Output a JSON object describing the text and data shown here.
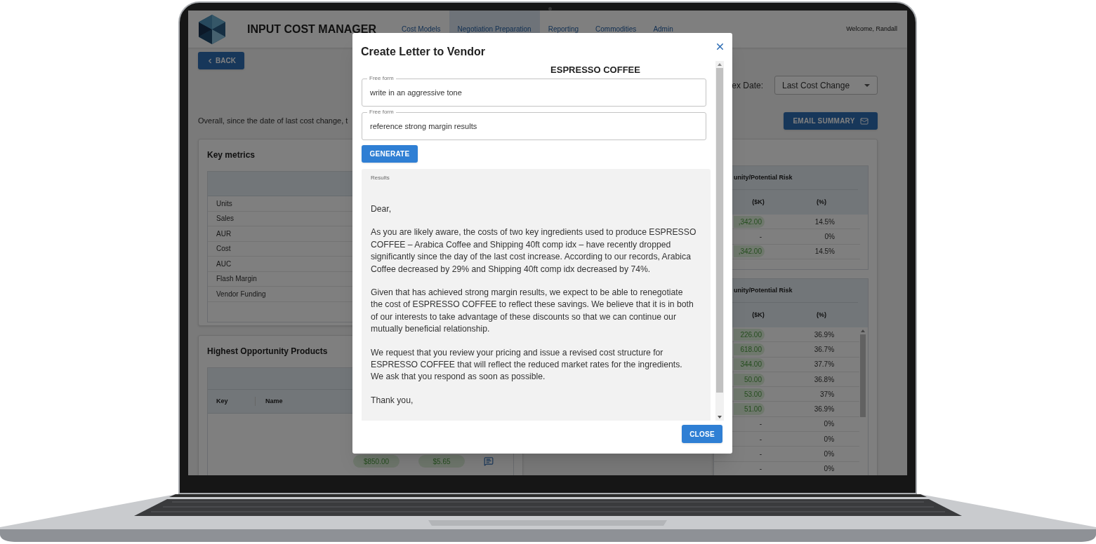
{
  "app": {
    "title": "INPUT COST MANAGER",
    "welcome": "Welcome, Randall",
    "nav": [
      {
        "label": "Cost Models",
        "selected": false
      },
      {
        "label": "Negotiation Preparation",
        "selected": true
      },
      {
        "label": "Reporting",
        "selected": false
      },
      {
        "label": "Commodities",
        "selected": false
      },
      {
        "label": "Admin",
        "selected": false
      }
    ]
  },
  "back_button": "BACK",
  "index_date": {
    "label": "ex Date:",
    "value": "Last Cost Change"
  },
  "summary_text": "Overall, since the date of last cost change, t",
  "email_button": "EMAIL SUMMARY",
  "key_metrics": {
    "title": "Key metrics",
    "rows": [
      "Units",
      "Sales",
      "AUR",
      "Cost",
      "AUC",
      "Flash Margin",
      "Vendor Funding"
    ]
  },
  "highest_products": {
    "title": "Highest Opportunity Products",
    "columns": [
      "Key",
      "Name"
    ],
    "rows": [
      {
        "cells": [
          "$850.00",
          "$5.65"
        ]
      }
    ]
  },
  "risk_tables": [
    {
      "group_header": "unity/Potential Risk",
      "columns": [
        "($K)",
        "(%)"
      ],
      "rows": [
        {
          "amount": ",342.00",
          "pct": "14.5%",
          "highlighted": true
        },
        {
          "amount": "-",
          "pct": "0%",
          "highlighted": false
        },
        {
          "amount": ",342.00",
          "pct": "14.5%",
          "highlighted": true
        }
      ]
    },
    {
      "group_header": "unity/Potential Risk",
      "columns": [
        "($K)",
        "(%)"
      ],
      "rows": [
        {
          "amount": "226.00",
          "pct": "36.9%",
          "highlighted": true
        },
        {
          "amount": "618.00",
          "pct": "36.7%",
          "highlighted": true
        },
        {
          "amount": "344.00",
          "pct": "37.7%",
          "highlighted": true
        },
        {
          "amount": "50.00",
          "pct": "36.8%",
          "highlighted": true
        },
        {
          "amount": "53.00",
          "pct": "37%",
          "highlighted": true
        },
        {
          "amount": "51.00",
          "pct": "36.9%",
          "highlighted": true
        },
        {
          "amount": "-",
          "pct": "0%",
          "highlighted": false
        },
        {
          "amount": "-",
          "pct": "0%",
          "highlighted": false
        },
        {
          "amount": "-",
          "pct": "0%",
          "highlighted": false
        },
        {
          "amount": "-",
          "pct": "0%",
          "highlighted": false
        }
      ]
    }
  ],
  "dialog": {
    "title": "Create Letter to Vendor",
    "product": "ESPRESSO COFFEE",
    "fields": [
      {
        "label": "Free form",
        "value": "write in an aggressive tone"
      },
      {
        "label": "Free form",
        "value": "reference strong margin results"
      }
    ],
    "generate_button": "GENERATE",
    "results_label": "Results",
    "letter": [
      "Dear,",
      "As you are likely aware, the costs of two key ingredients used to produce ESPRESSO COFFEE – Arabica Coffee and Shipping 40ft comp idx – have recently dropped significantly since the day of the last cost increase. According to our records, Arabica Coffee decreased by 29% and Shipping 40ft comp idx decreased by 74%.",
      "Given that has achieved strong margin results, we expect to be able to renegotiate the cost of ESPRESSO COFFEE to reflect these savings. We believe that it is in both of our interests to take advantage of these discounts so that we can continue our mutually beneficial relationship.",
      "We request that you review your pricing and issue a revised cost structure for ESPRESSO COFFEE that will reflect the reduced market rates for the ingredients. We ask that you respond as soon as possible.",
      "Thank you,"
    ],
    "close_button": "CLOSE"
  }
}
